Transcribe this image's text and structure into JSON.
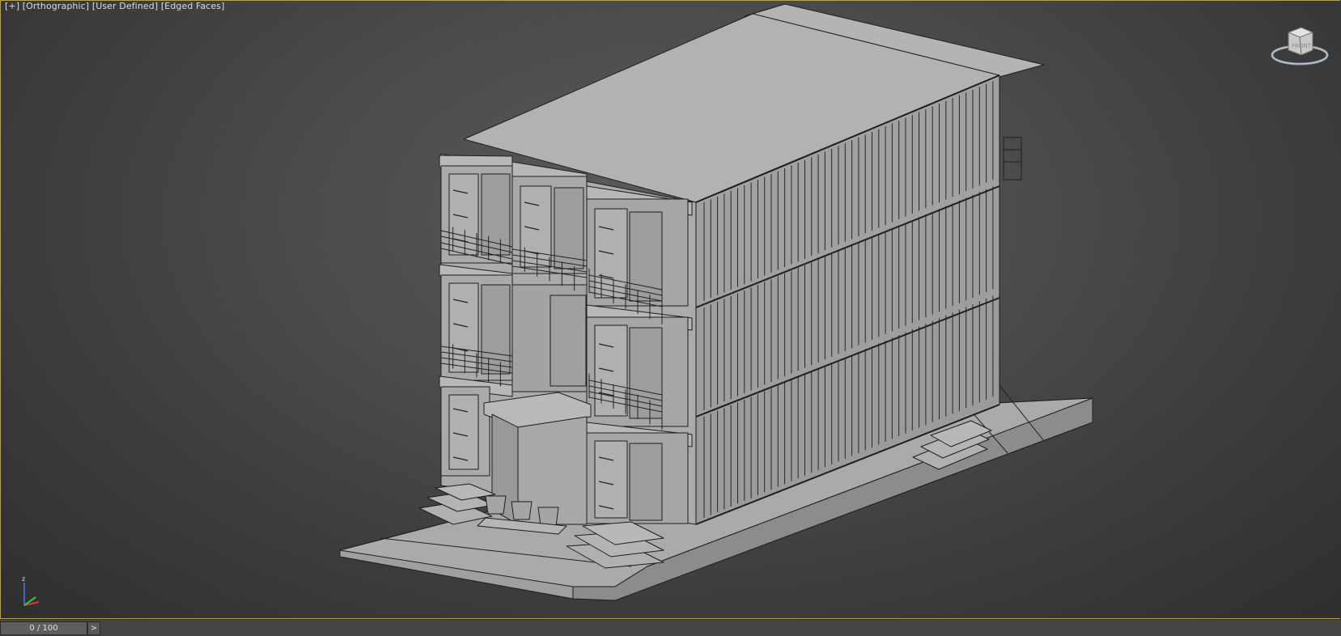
{
  "viewport": {
    "labels": [
      "[+]",
      "[Orthographic]",
      "[User Defined]",
      "[Edged Faces]"
    ]
  },
  "viewcube": {
    "face": "FRONT",
    "icon": "viewcube-icon"
  },
  "axis_tripod": {
    "icon": "axis-tripod-icon",
    "z_label": "z"
  },
  "timeline": {
    "frame": "0 / 100",
    "next_label": ">"
  },
  "colors": {
    "viewport_border": "#b8a24a",
    "model_face": "#a9a9a9",
    "edge": "#1e1e1e"
  }
}
